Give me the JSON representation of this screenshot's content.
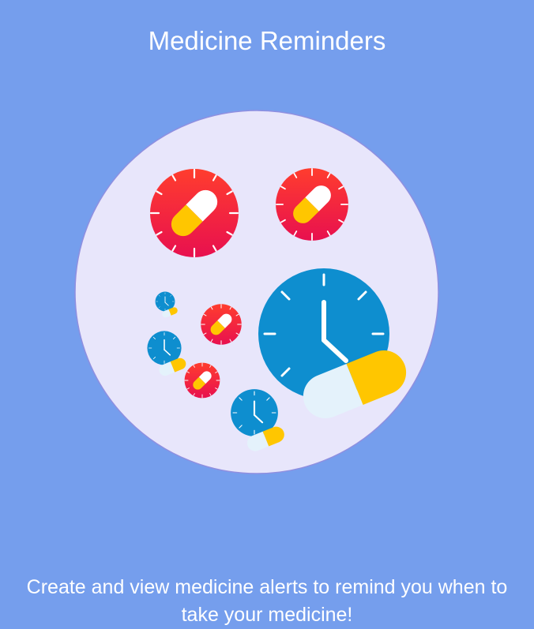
{
  "screen": {
    "title": "Medicine Reminders",
    "description": "Create and view medicine alerts to remind you when to take your medicine!"
  },
  "illustration": {
    "icons": [
      "pill-timer-icon",
      "clock-icon",
      "capsule-icon"
    ]
  },
  "colors": {
    "background": "#759eed",
    "circle": "#e8e6fb",
    "red_timer": "#ee1847",
    "blue_clock": "#0e8ecf",
    "capsule_yellow": "#ffc600",
    "capsule_white": "#e4f2fb"
  }
}
